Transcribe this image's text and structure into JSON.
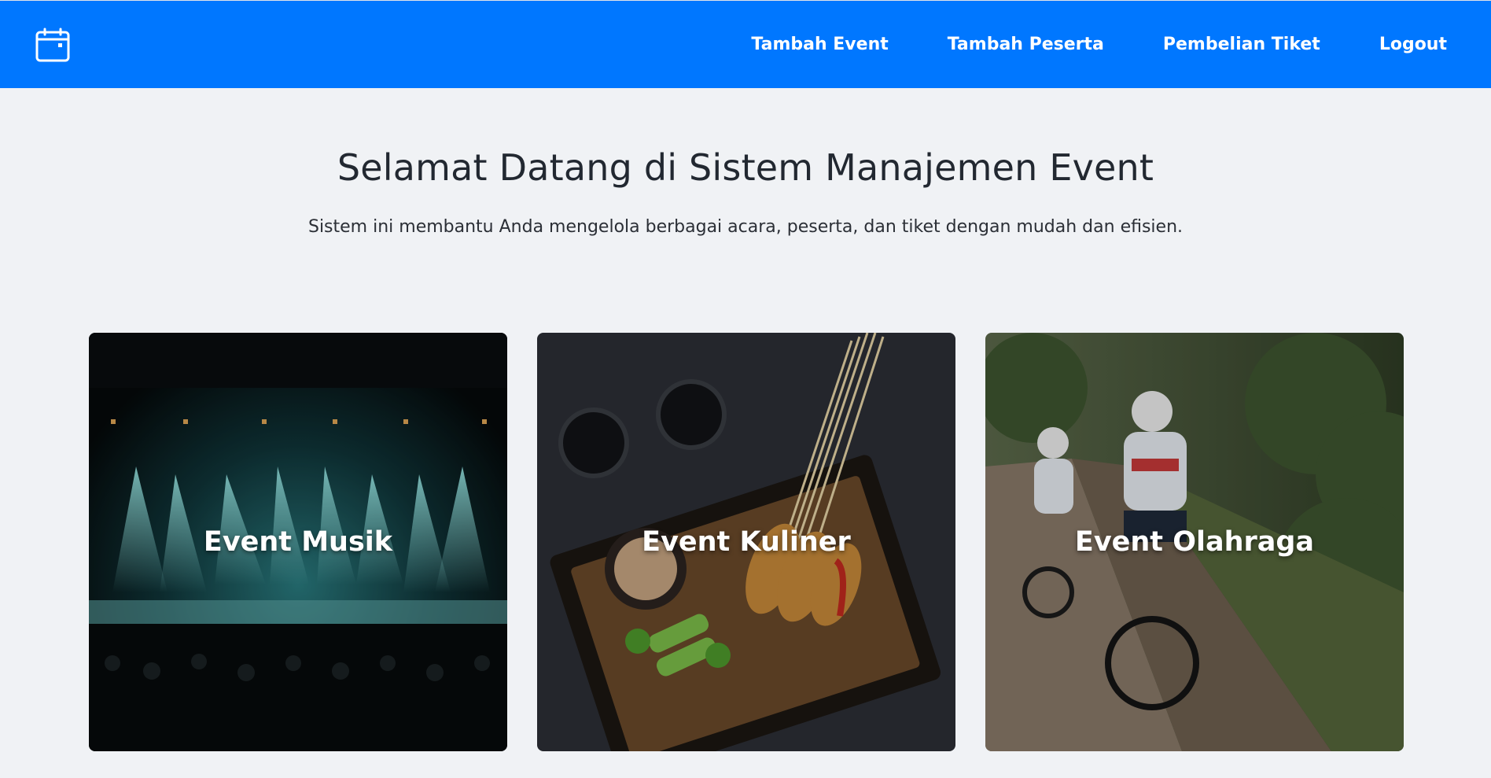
{
  "nav": {
    "logo_icon": "calendar-icon",
    "links": [
      "Tambah Event",
      "Tambah Peserta",
      "Pembelian Tiket",
      "Logout"
    ],
    "background": "#0077ff"
  },
  "hero": {
    "title": "Selamat Datang di Sistem Manajemen Event",
    "subtitle": "Sistem ini membantu Anda mengelola berbagai acara, peserta, dan tiket dengan mudah dan efisien."
  },
  "cards": [
    {
      "label": "Event Musik",
      "image": "concert-stage-image"
    },
    {
      "label": "Event Kuliner",
      "image": "satay-dish-image"
    },
    {
      "label": "Event Olahraga",
      "image": "cyclists-image"
    }
  ]
}
